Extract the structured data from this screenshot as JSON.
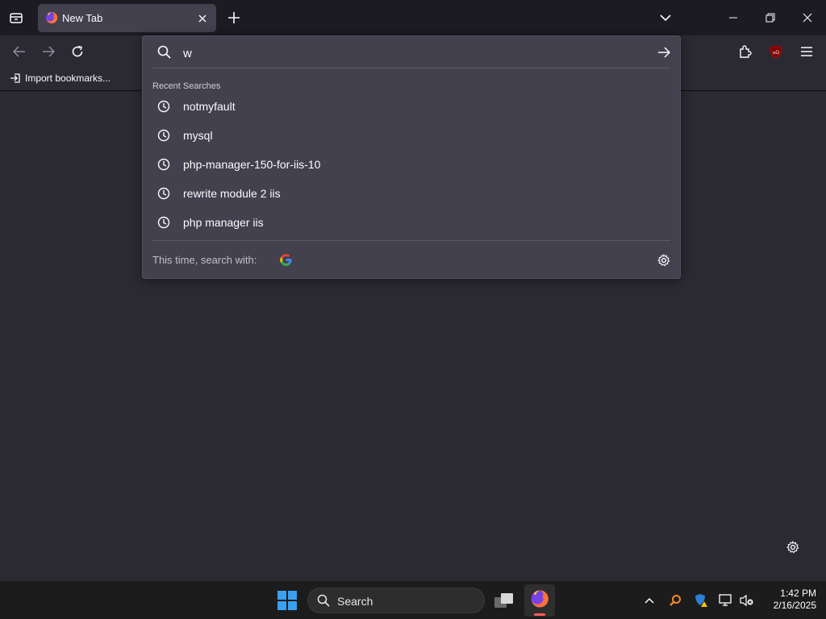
{
  "colors": {
    "chrome_dark": "#1c1b22",
    "toolbar": "#2b2a33",
    "tab_selected": "#42414d",
    "popup_bg": "#42414d",
    "taskbar": "#1c1c1c",
    "ublock_red": "#800000"
  },
  "tabbar": {
    "tab_title": "New Tab",
    "icons": {
      "list_all_tabs": "tab-list-icon",
      "close_tab": "close-icon",
      "new_tab": "plus-icon",
      "tab_overflow": "chevron-down-icon",
      "minimize": "minimize-icon",
      "restore": "restore-icon",
      "close_window": "close-window-icon"
    }
  },
  "navbar": {
    "icons": {
      "back": "back-arrow-icon",
      "forward": "forward-arrow-icon",
      "reload": "reload-icon",
      "extensions": "puzzle-icon",
      "ublock": "ublock-origin-icon",
      "menu": "hamburger-menu-icon"
    }
  },
  "bookmarks": {
    "import_label": "Import bookmarks..."
  },
  "urlbar": {
    "value": "w",
    "recent_label": "Recent Searches",
    "results": [
      {
        "text": "notmyfault",
        "icon": "history-clock-icon"
      },
      {
        "text": "mysql",
        "icon": "history-clock-icon"
      },
      {
        "text": "php-manager-150-for-iis-10",
        "icon": "history-clock-icon"
      },
      {
        "text": "rewrite module 2 iis",
        "icon": "history-clock-icon"
      },
      {
        "text": "php manager iis",
        "icon": "history-clock-icon"
      }
    ],
    "search_with_label": "This time, search with:",
    "engine_icon": "google-icon",
    "settings_icon": "gear-icon"
  },
  "newtab": {
    "settings_icon": "gear-icon"
  },
  "taskbar": {
    "search_label": "Search",
    "clock_time": "1:42 PM",
    "clock_date": "2/16/2025"
  }
}
